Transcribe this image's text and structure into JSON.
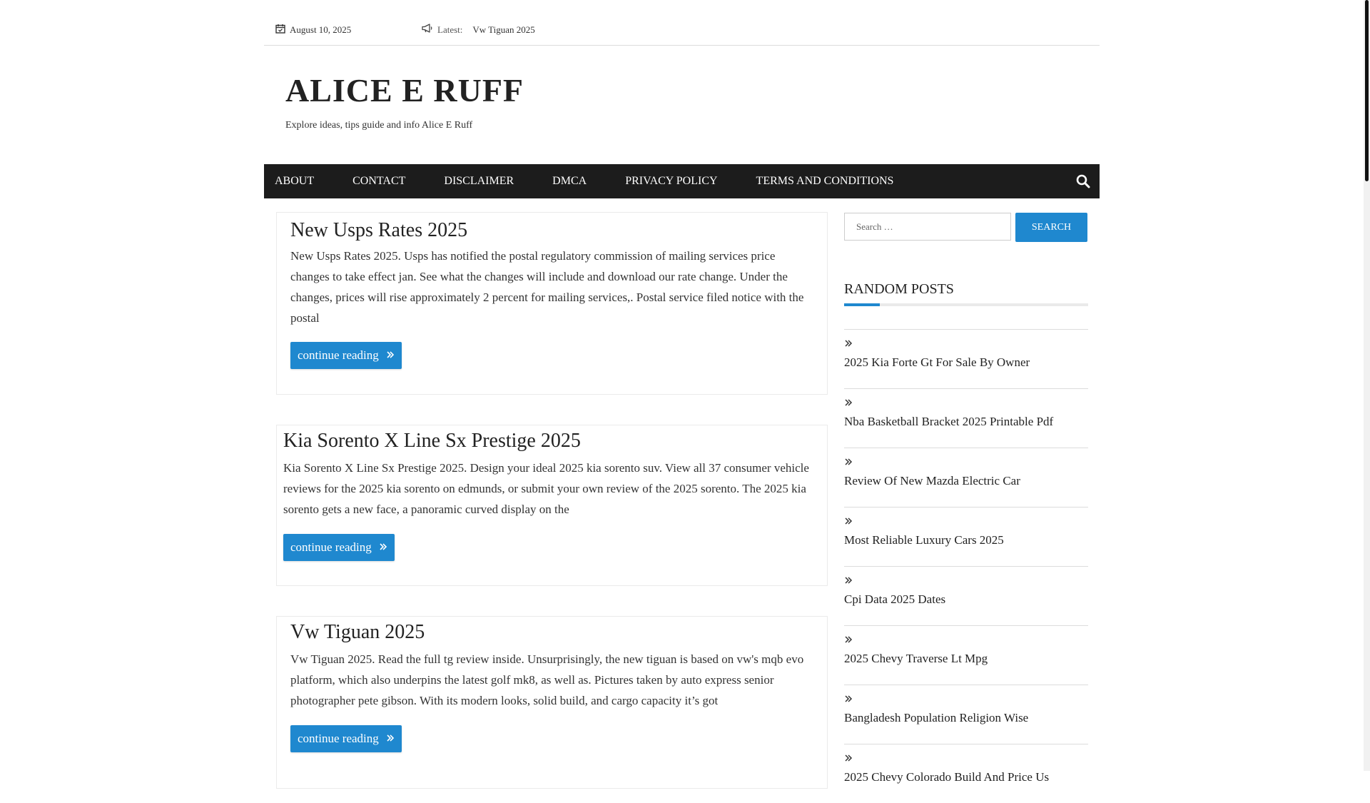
{
  "topbar": {
    "date": "August 10, 2025",
    "latest_label": "Latest:",
    "latest_link": "Vw Tiguan 2025"
  },
  "site": {
    "title": "ALICE E RUFF",
    "description": "Explore ideas, tips guide and info Alice E Ruff"
  },
  "nav": {
    "items": [
      "ABOUT",
      "CONTACT",
      "DISCLAIMER",
      "DMCA",
      "PRIVACY POLICY",
      "TERMS AND CONDITIONS"
    ]
  },
  "articles": [
    {
      "title": "New Usps Rates 2025",
      "excerpt": "New Usps Rates 2025. Usps has notified the postal regulatory commission of mailing services price changes to take effect jan. See what the changes will include and download our rate change. Under the changes, prices will rise approximately 2 percent for mailing services,. Postal service filed notice with the postal",
      "button": "continue reading"
    },
    {
      "title": "Kia Sorento X Line Sx Prestige 2025",
      "excerpt": "Kia Sorento X Line Sx Prestige 2025. Design your ideal 2025 kia sorento suv. View all 37 consumer vehicle reviews for the 2025 kia sorento on edmunds, or submit your own review of the 2025 sorento. The 2025 kia sorento gets a new face, a panoramic curved display on the",
      "button": "continue reading"
    },
    {
      "title": "Vw Tiguan 2025",
      "excerpt": "Vw Tiguan 2025. Read the full tg review inside. Unsurprisingly, the new tiguan is based on vw's mqb evo platform, which also underpins the latest golf mk8, as well as. Pictures taken by auto express senior photographer pete gibson. With its modern looks, solid build, and cargo capacity it’s got",
      "button": "continue reading"
    }
  ],
  "sidebar": {
    "search_placeholder": "Search …",
    "search_button": "SEARCH",
    "widget_title": "RANDOM POSTS",
    "posts": [
      "2025 Kia Forte Gt For Sale By Owner",
      "Nba Basketball Bracket 2025 Printable Pdf",
      "Review Of New Mazda Electric Car",
      "Most Reliable Luxury Cars 2025",
      "Cpi Data 2025 Dates",
      "2025 Chevy Traverse Lt Mpg",
      "Bangladesh Population Religion Wise",
      "2025 Chevy Colorado Build And Price Us"
    ]
  },
  "colors": {
    "accent": "#1f88cf",
    "nav_bg": "#1c1c1c"
  }
}
